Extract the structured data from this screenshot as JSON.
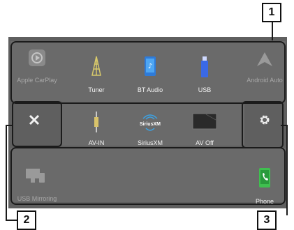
{
  "callouts": {
    "one": "1",
    "two": "2",
    "three": "3"
  },
  "sources": {
    "apple_carplay": "Apple CarPlay",
    "tuner": "Tuner",
    "bt_audio": "BT Audio",
    "usb": "USB",
    "android_auto": "Android Auto",
    "av_in": "AV-IN",
    "siriusxm": "SiriusXM",
    "av_off": "AV Off",
    "usb_mirroring": "USB Mirroring",
    "phone": "Phone"
  },
  "siriusxm_logo_text": "SiriusXM"
}
